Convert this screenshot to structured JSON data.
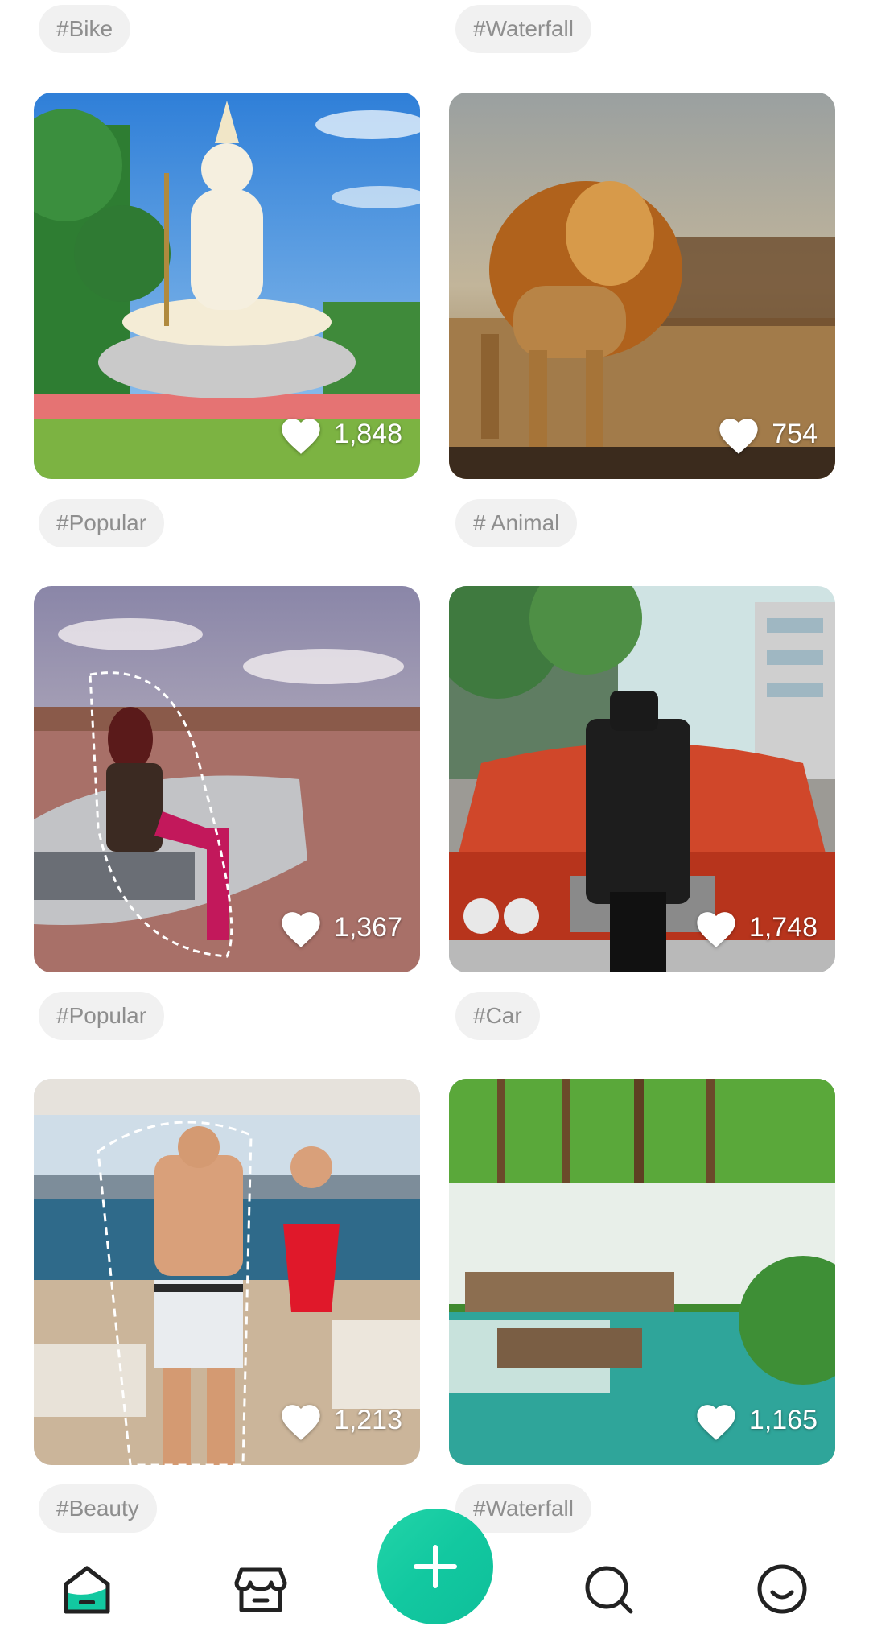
{
  "feed": {
    "top_tags": [
      "#Bike",
      "#Waterfall"
    ],
    "rows": [
      {
        "cards": [
          {
            "likes": "1,848",
            "tag": "#Popular",
            "scene": "statue"
          },
          {
            "likes": "754",
            "tag": "# Animal",
            "scene": "lion"
          }
        ]
      },
      {
        "cards": [
          {
            "likes": "1,367",
            "tag": "#Popular",
            "scene": "car-woman"
          },
          {
            "likes": "1,748",
            "tag": "#Car",
            "scene": "red-car"
          }
        ]
      },
      {
        "cards": [
          {
            "likes": "1,213",
            "tag": "#Beauty",
            "scene": "yacht"
          },
          {
            "likes": "1,165",
            "tag": "#Waterfall",
            "scene": "waterfall"
          }
        ]
      }
    ]
  },
  "icons": {
    "like": "heart-icon",
    "nav": [
      "home-icon",
      "store-icon",
      "plus-icon",
      "search-icon",
      "profile-icon"
    ]
  },
  "colors": {
    "accent": "#12c8a0",
    "tag_bg": "#f1f1f1",
    "tag_text": "#8e8e8e",
    "nav_icon": "#222222"
  }
}
